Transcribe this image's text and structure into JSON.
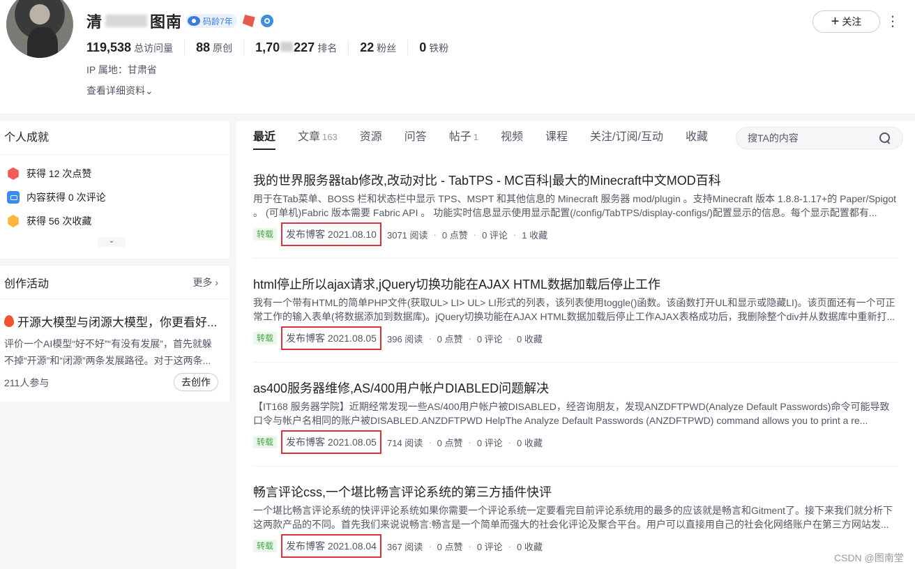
{
  "profile": {
    "name_left": "清",
    "name_right": "图南",
    "years_badge": "码龄7年",
    "stats": [
      {
        "num": "119,538",
        "label": "总访问量"
      },
      {
        "num": "88",
        "label": "原创"
      },
      {
        "num_pre": "1,70",
        "num_post": "227",
        "label": "排名"
      },
      {
        "num": "22",
        "label": "粉丝"
      },
      {
        "num": "0",
        "label": "铁粉"
      }
    ],
    "ip": "IP 属地：甘肃省",
    "detail_link": "查看详细资料",
    "follow_label": "关注",
    "follow_plus": "+",
    "more_dots": "⋮"
  },
  "achievements": {
    "title": "个人成就",
    "items": [
      {
        "text": "获得 12 次点赞",
        "icon": "like-icon"
      },
      {
        "text": "内容获得 0 次评论",
        "icon": "comment-icon"
      },
      {
        "text": "获得 56 次收藏",
        "icon": "favorite-icon"
      }
    ],
    "expand": "⌄"
  },
  "activity": {
    "title": "创作活动",
    "more": "更多 ›",
    "topic": "开源大模型与闭源大模型，你更看好...",
    "desc": "评价一个AI模型“好不好”“有没有发展”，首先就躲不掉“开源”和“闭源”两条发展路径。对于这两条...",
    "count": "211人参与",
    "button": "去创作"
  },
  "tabs": [
    {
      "label": "最近",
      "count": "",
      "active": true
    },
    {
      "label": "文章",
      "count": "163"
    },
    {
      "label": "资源",
      "count": ""
    },
    {
      "label": "问答",
      "count": ""
    },
    {
      "label": "帖子",
      "count": "1"
    },
    {
      "label": "视频",
      "count": ""
    },
    {
      "label": "课程",
      "count": ""
    },
    {
      "label": "关注/订阅/互动",
      "count": ""
    },
    {
      "label": "收藏",
      "count": ""
    }
  ],
  "search": {
    "placeholder": "搜TA的内容"
  },
  "articles": [
    {
      "title": "我的世界服务器tab修改,改动对比 - TabTPS - MC百科|最大的Minecraft中文MOD百科",
      "desc": "用于在Tab菜单、BOSS 栏和状态栏中显示 TPS、MSPT 和其他信息的 Minecraft 服务器 mod/plugin 。支持Minecraft 版本 1.8.8-1.17+的 Paper/Spigot 。 (可单机)Fabric 版本需要 Fabric API 。 功能实时信息显示使用显示配置(/config/TabTPS/display-configs/)配置显示的信息。每个显示配置都有...",
      "tag": "转载",
      "date": "发布博客 2021.08.10",
      "reads": "3071 阅读",
      "likes": "0 点赞",
      "comments": "0 评论",
      "favs": "1 收藏"
    },
    {
      "title": "html停止所以ajax请求,jQuery切换功能在AJAX HTML数据加载后停止工作",
      "desc": "我有一个带有HTML的简单PHP文件(获取UL> LI> UL> LI形式的列表，该列表使用toggle()函数。该函数打开UL和显示或隐藏LI)。该页面还有一个可正常工作的输入表单(将数据添加到数据库)。jQuery切换功能在AJAX HTML数据加载后停止工作AJAX表格成功后，我删除整个div并从数据库中重新打...",
      "tag": "转载",
      "date": "发布博客 2021.08.05",
      "reads": "396 阅读",
      "likes": "0 点赞",
      "comments": "0 评论",
      "favs": "0 收藏"
    },
    {
      "title": "as400服务器维修,AS/400用户帐户DIABLED问题解决",
      "desc": "【IT168 服务器学院】近期经常发现一些AS/400用户帐户被DISABLED，经咨询朋友，发现ANZDFTPWD(Analyze Default Passwords)命令可能导致口令与帐户名相同的账户被DISABLED.ANZDFTPWD HelpThe Analyze Default Passwords (ANZDFTPWD) command allows you to print a re...",
      "tag": "转载",
      "date": "发布博客 2021.08.05",
      "reads": "714 阅读",
      "likes": "0 点赞",
      "comments": "0 评论",
      "favs": "0 收藏"
    },
    {
      "title": "畅言评论css,一个堪比畅言评论系统的第三方插件快评",
      "desc": "一个堪比畅言评论系统的快评评论系统如果你需要一个评论系统一定要看完目前评论系统用的最多的应该就是畅言和Gitment了。接下来我们就分析下这两款产品的不同。首先我们来说说畅言:畅言是一个简单而强大的社会化评论及聚合平台。用户可以直接用自己的社会化网络账户在第三方网站发...",
      "tag": "转载",
      "date": "发布博客 2021.08.04",
      "reads": "367 阅读",
      "likes": "0 点赞",
      "comments": "0 评论",
      "favs": "0 收藏"
    }
  ],
  "watermark": "CSDN @图南堂"
}
